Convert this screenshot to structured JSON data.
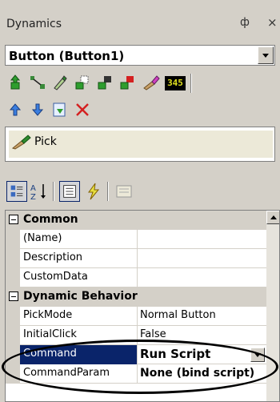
{
  "window": {
    "title": "Dynamics",
    "pin_glyph": "ф",
    "close_glyph": "×"
  },
  "selector": {
    "value": "Button (Button1)"
  },
  "toolbar1": {
    "icons": [
      "add-dynamic-icon",
      "connect-icon",
      "edit-icon",
      "copy-icon",
      "move-icon",
      "delete-dynamic-icon",
      "pick-icon",
      "counter-icon"
    ],
    "counter_text": "345"
  },
  "toolbar2": {
    "icons": [
      "move-up-icon",
      "move-down-icon",
      "paste-icon",
      "delete-icon"
    ]
  },
  "pick": {
    "label": "Pick"
  },
  "property_toolbar": {
    "icons": [
      "categorized-icon",
      "alphabetical-icon",
      "properties-icon",
      "events-icon",
      "property-pages-icon"
    ]
  },
  "grid": {
    "categories": [
      {
        "label": "Common"
      },
      {
        "label": "Dynamic Behavior"
      }
    ],
    "common_props": [
      {
        "name": "(Name)",
        "value": ""
      },
      {
        "name": "Description",
        "value": ""
      },
      {
        "name": "CustomData",
        "value": ""
      }
    ],
    "behavior_props": [
      {
        "name": "PickMode",
        "value": "Normal Button"
      },
      {
        "name": "InitialClick",
        "value": "False"
      },
      {
        "name": "Command",
        "value": "Run Script"
      },
      {
        "name": "CommandParam",
        "value": "None (bind script)"
      }
    ]
  },
  "colors": {
    "selection": "#0a246a",
    "chrome": "#d4d0c8"
  }
}
